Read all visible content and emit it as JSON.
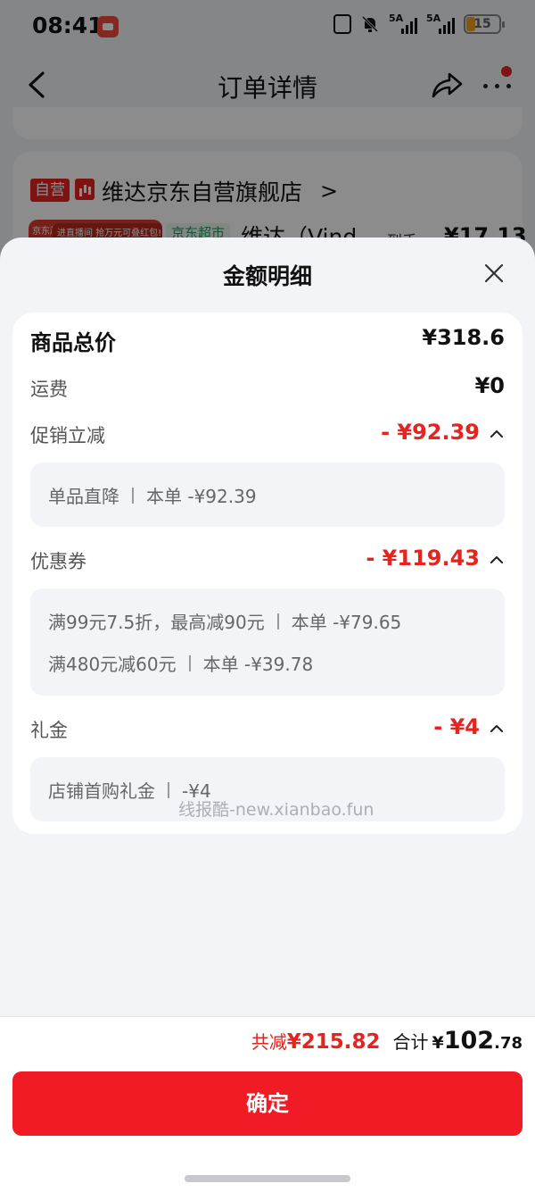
{
  "status_bar": {
    "time": "08:41",
    "signal1_label": "5A",
    "signal2_label": "5A",
    "battery": "15"
  },
  "nav": {
    "title": "订单详情"
  },
  "store": {
    "self_tag": "自营",
    "name": "维达京东自营旗舰店",
    "chevron": ">",
    "product_brand": "京东超市",
    "product_banner": "进直播间 抢万元可叠红包!",
    "super_tag": "京东超市",
    "product_name": "维达（Vind...",
    "arrive_label": "到手",
    "arrive_price": "¥17.13"
  },
  "sheet": {
    "title": "金额明细",
    "rows": {
      "total": {
        "label": "商品总价",
        "value": "¥318.6"
      },
      "shipping": {
        "label": "运费",
        "value": "¥0"
      },
      "promo": {
        "label": "促销立减",
        "value": "- ¥92.39"
      },
      "coupon": {
        "label": "优惠券",
        "value": "- ¥119.43"
      },
      "gift": {
        "label": "礼金",
        "value": "- ¥4"
      }
    },
    "promo_details": [
      {
        "name": "单品直降",
        "amount": "本单 -¥92.39"
      }
    ],
    "coupon_details": [
      {
        "name": "满99元7.5折，最高减90元",
        "amount": "本单 -¥79.65"
      },
      {
        "name": "满480元减60元",
        "amount": "本单 -¥39.78"
      }
    ],
    "gift_details": [
      {
        "name": "店铺首购礼金",
        "amount": "-¥4"
      }
    ],
    "watermark": "线报酷-new.xianbao.fun"
  },
  "footer": {
    "saved_label": "共减",
    "saved_value": "¥215.82",
    "sum_label": "合计",
    "sum_yen": "¥",
    "sum_int": "102",
    "sum_dec": ".78",
    "confirm": "确定"
  },
  "colors": {
    "accent_red": "#e6231f",
    "button_red": "#f01b24",
    "sheet_bg": "#f3f4f8"
  }
}
